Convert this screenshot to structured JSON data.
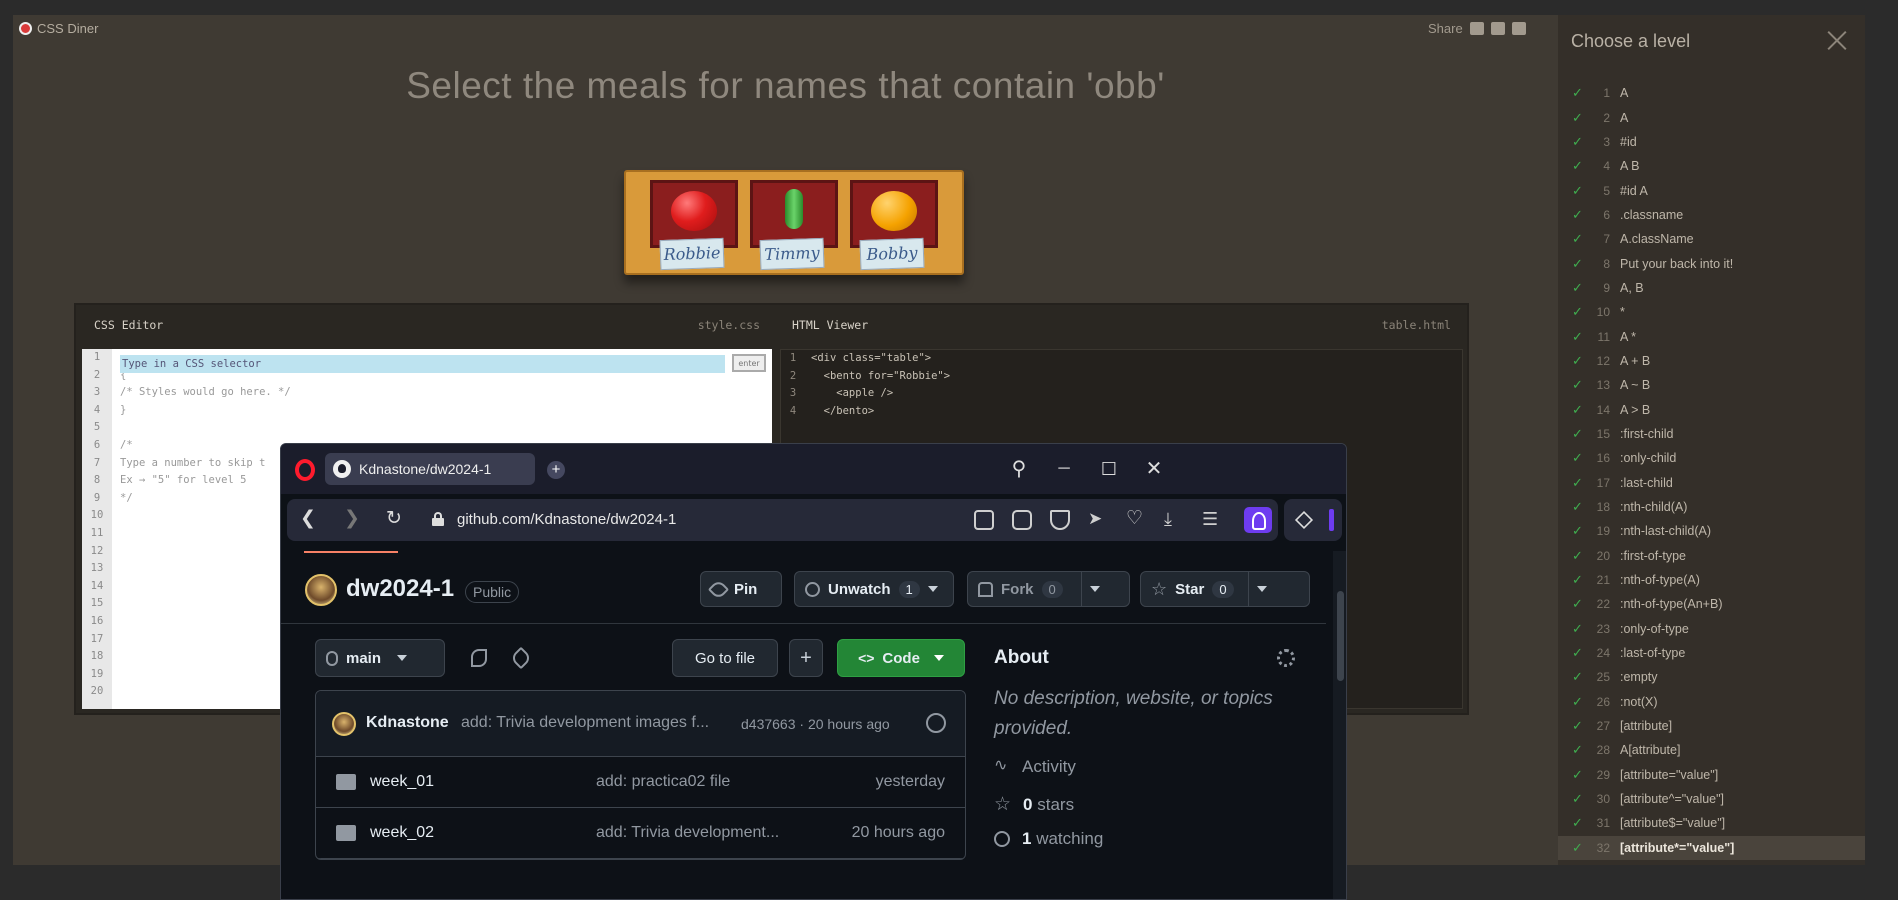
{
  "diner": {
    "brand": "CSS Diner",
    "share_label": "Share",
    "instruction": "Select the meals for names that contain 'obb'",
    "table": {
      "bentos": [
        {
          "food": "apple",
          "name": "Robbie"
        },
        {
          "food": "pickle",
          "name": "Timmy"
        },
        {
          "food": "orange",
          "name": "Bobby"
        }
      ]
    },
    "css_editor": {
      "title": "CSS Editor",
      "filename": "style.css",
      "placeholder": "Type in a CSS selector",
      "enter_label": "enter",
      "line_numbers": [
        "1",
        "2",
        "3",
        "4",
        "5",
        "6",
        "7",
        "8",
        "9",
        "10",
        "11",
        "12",
        "13",
        "14",
        "15",
        "16",
        "17",
        "18",
        "19",
        "20"
      ],
      "lines": [
        "",
        "{",
        "/* Styles would go here. */",
        "}",
        "",
        "/*",
        "Type a number to skip t",
        "Ex → \"5\" for level 5",
        "*/"
      ]
    },
    "html_viewer": {
      "title": "HTML Viewer",
      "filename": "table.html",
      "line_numbers": [
        "1",
        "2",
        "3",
        "4"
      ],
      "lines": [
        "<div class=\"table\">",
        "  <bento for=\"Robbie\">",
        "    <apple />",
        "  </bento>"
      ]
    }
  },
  "levels": {
    "title": "Choose a level",
    "current": 32,
    "items": [
      {
        "num": "1",
        "label": "A"
      },
      {
        "num": "2",
        "label": "A"
      },
      {
        "num": "3",
        "label": "#id"
      },
      {
        "num": "4",
        "label": "A  B"
      },
      {
        "num": "5",
        "label": "#id  A"
      },
      {
        "num": "6",
        "label": ".classname"
      },
      {
        "num": "7",
        "label": "A.className"
      },
      {
        "num": "8",
        "label": "Put your back into it!"
      },
      {
        "num": "9",
        "label": "A, B"
      },
      {
        "num": "10",
        "label": "*"
      },
      {
        "num": "11",
        "label": "A  *"
      },
      {
        "num": "12",
        "label": "A + B"
      },
      {
        "num": "13",
        "label": "A ~ B"
      },
      {
        "num": "14",
        "label": "A > B"
      },
      {
        "num": "15",
        "label": ":first-child"
      },
      {
        "num": "16",
        "label": ":only-child"
      },
      {
        "num": "17",
        "label": ":last-child"
      },
      {
        "num": "18",
        "label": ":nth-child(A)"
      },
      {
        "num": "19",
        "label": ":nth-last-child(A)"
      },
      {
        "num": "20",
        "label": ":first-of-type"
      },
      {
        "num": "21",
        "label": ":nth-of-type(A)"
      },
      {
        "num": "22",
        "label": ":nth-of-type(An+B)"
      },
      {
        "num": "23",
        "label": ":only-of-type"
      },
      {
        "num": "24",
        "label": ":last-of-type"
      },
      {
        "num": "25",
        "label": ":empty"
      },
      {
        "num": "26",
        "label": ":not(X)"
      },
      {
        "num": "27",
        "label": "[attribute]"
      },
      {
        "num": "28",
        "label": "A[attribute]"
      },
      {
        "num": "29",
        "label": "[attribute=\"value\"]"
      },
      {
        "num": "30",
        "label": "[attribute^=\"value\"]"
      },
      {
        "num": "31",
        "label": "[attribute$=\"value\"]"
      },
      {
        "num": "32",
        "label": "[attribute*=\"value\"]"
      }
    ]
  },
  "browser": {
    "tab_title": "Kdnastone/dw2024-1",
    "new_tab": "+",
    "url": "github.com/Kdnastone/dw2024-1"
  },
  "github": {
    "repo_name": "dw2024-1",
    "visibility": "Public",
    "pin_label": "Pin",
    "unwatch_label": "Unwatch",
    "watch_count": "1",
    "fork_label": "Fork",
    "fork_count": "0",
    "star_label": "Star",
    "star_count": "0",
    "branch": "main",
    "goto_file_label": "Go to file",
    "add_label": "+",
    "code_label": "Code",
    "commit": {
      "author": "Kdnastone",
      "message": "add: Trivia development images f...",
      "meta": "d437663 · 20 hours ago"
    },
    "files": [
      {
        "name": "week_01",
        "message": "add: practica02 file",
        "date": "yesterday"
      },
      {
        "name": "week_02",
        "message": "add: Trivia development...",
        "date": "20 hours ago"
      }
    ],
    "about": {
      "title": "About",
      "description": "No description, website, or topics provided.",
      "activity": "Activity",
      "stars_count": "0",
      "stars_label": "stars",
      "watching_count": "1",
      "watching_label": "watching"
    }
  }
}
